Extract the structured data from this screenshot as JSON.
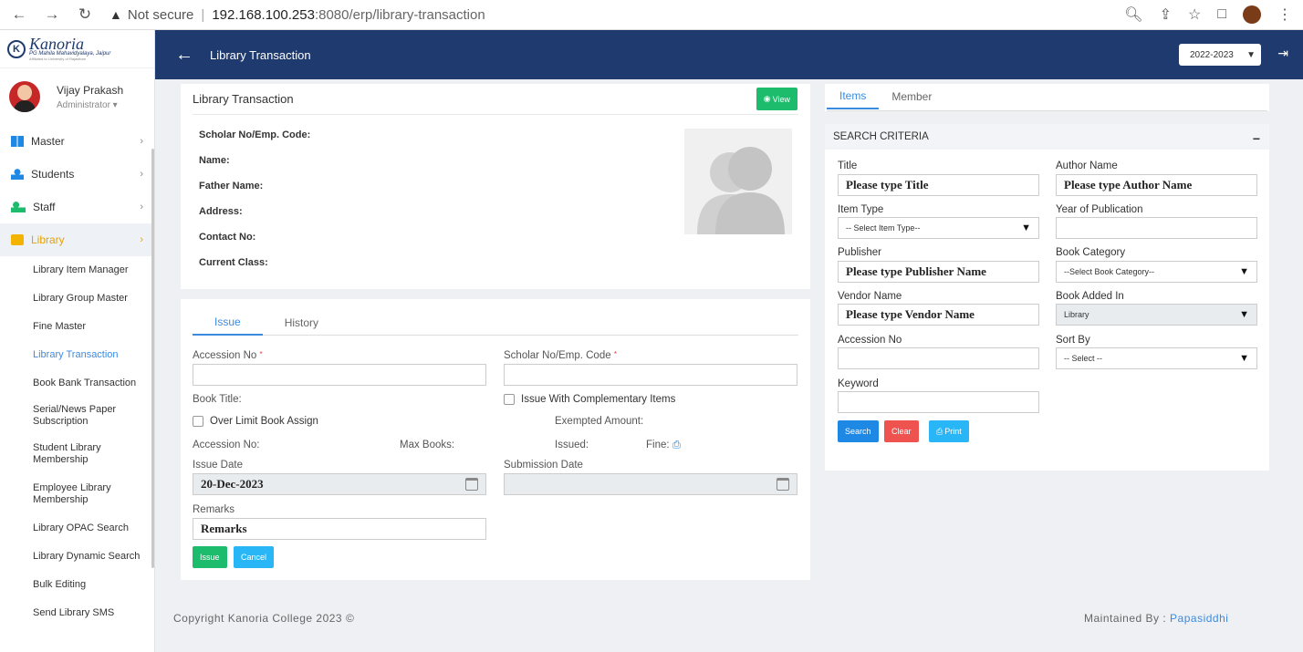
{
  "browser": {
    "security_label": "Not secure",
    "url_host": "192.168.100.253",
    "url_port_path": ":8080/erp/library-transaction"
  },
  "sidebar": {
    "logo_name": "Kanoria",
    "logo_sub": "PG Mahila Mahavidyalaya, Jaipur",
    "logo_sub2": "Affiliated to University of Rajasthan",
    "user_name": "Vijay Prakash",
    "user_role": "Administrator",
    "menu": [
      {
        "label": "Master"
      },
      {
        "label": "Students"
      },
      {
        "label": "Staff"
      },
      {
        "label": "Library"
      }
    ],
    "submenu": [
      "Library Item Manager",
      "Library Group Master",
      "Fine Master",
      "Library Transaction",
      "Book Bank Transaction",
      "Serial/News Paper Subscription",
      "Student Library Membership",
      "Employee Library Membership",
      "Library OPAC Search",
      "Library Dynamic Search",
      "Bulk Editing",
      "Send Library SMS"
    ]
  },
  "topbar": {
    "title": "Library Transaction",
    "year": "2022-2023"
  },
  "detail_card": {
    "title": "Library Transaction",
    "view_label": "View",
    "fields": [
      "Scholar No/Emp. Code:",
      "Name:",
      "Father Name:",
      "Address:",
      "Contact No:",
      "Current Class:"
    ]
  },
  "issue_card": {
    "tabs": [
      "Issue",
      "History"
    ],
    "accession_label": "Accession No",
    "scholar_label": "Scholar No/Emp. Code",
    "book_title_label": "Book Title:",
    "complementary_label": "Issue With Complementary Items",
    "over_limit_label": "Over Limit Book Assign",
    "exempted_label": "Exempted Amount:",
    "accession_no_label": "Accession No:",
    "max_books_label": "Max Books:",
    "issued_label": "Issued:",
    "fine_label": "Fine:",
    "issue_date_label": "Issue Date",
    "issue_date_value": "20-Dec-2023",
    "submission_date_label": "Submission Date",
    "remarks_label": "Remarks",
    "remarks_placeholder": "Remarks",
    "issue_button": "Issue",
    "cancel_button": "Cancel"
  },
  "search_panel": {
    "tabs": [
      "Items",
      "Member"
    ],
    "header": "SEARCH CRITERIA",
    "title_label": "Title",
    "title_placeholder": "Please type Title",
    "author_label": "Author Name",
    "author_placeholder": "Please type Author Name",
    "item_type_label": "Item Type",
    "item_type_value": "-- Select Item Type--",
    "year_label": "Year of Publication",
    "publisher_label": "Publisher",
    "publisher_placeholder": "Please type Publisher Name",
    "category_label": "Book Category",
    "category_value": "--Select Book Category--",
    "vendor_label": "Vendor Name",
    "vendor_placeholder": "Please type Vendor Name",
    "added_in_label": "Book Added In",
    "added_in_value": "Library",
    "accession_label": "Accession No",
    "sort_label": "Sort By",
    "sort_value": "-- Select --",
    "keyword_label": "Keyword",
    "search_button": "Search",
    "clear_button": "Clear",
    "print_button": "Print"
  },
  "footer": {
    "copyright": "Copyright Kanoria College 2023 ©",
    "maintained_prefix": "Maintained By : ",
    "maintained_link": "Papasiddhi"
  },
  "colors": {
    "topbar": "#1e3a6e",
    "accent": "#3a8be0",
    "library_active": "#e6a200",
    "green_button": "#1dbb6c"
  }
}
